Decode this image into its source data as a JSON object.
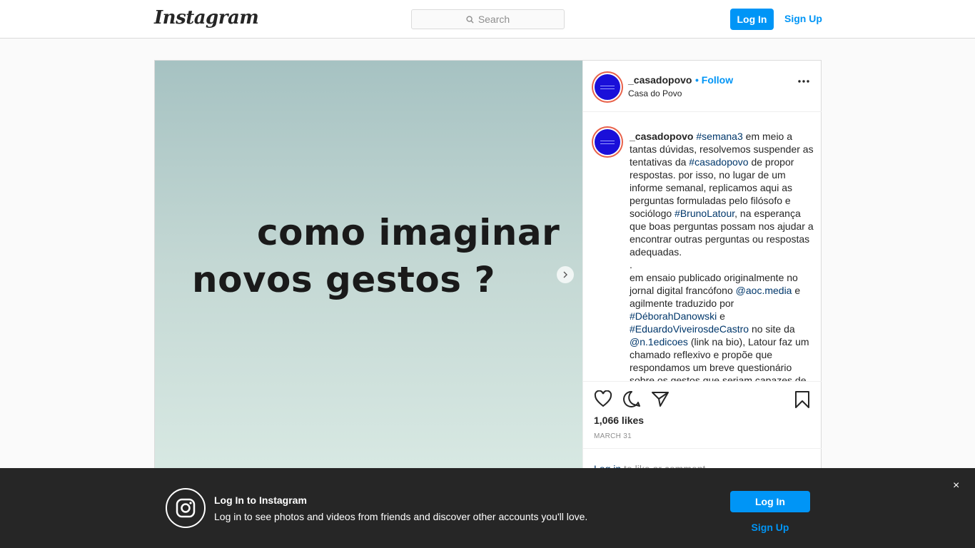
{
  "header": {
    "logo": "Instagram",
    "search_placeholder": "Search",
    "login_label": "Log In",
    "signup_label": "Sign Up"
  },
  "post": {
    "image_text_line1": "como imaginar",
    "image_text_line2": "novos gestos ?",
    "username": "_casadopovo",
    "follow_label": "• Follow",
    "full_name": "Casa do Povo",
    "caption": [
      {
        "t": "_casadopovo",
        "k": "u"
      },
      {
        "t": " ",
        "k": "p"
      },
      {
        "t": "#semana3",
        "k": "tag"
      },
      {
        "t": " em meio a tantas dúvidas, resolvemos suspender as tentativas da ",
        "k": "p"
      },
      {
        "t": "#casadopovo",
        "k": "tag"
      },
      {
        "t": " de propor respostas. por isso, no lugar de um informe semanal, replicamos aqui as perguntas formuladas pelo filósofo e sociólogo ",
        "k": "p"
      },
      {
        "t": "#BrunoLatour",
        "k": "tag"
      },
      {
        "t": ", na esperança que boas perguntas possam nos ajudar a encontrar outras perguntas ou respostas adequadas.",
        "k": "p"
      },
      {
        "t": "\n.\n",
        "k": "p"
      },
      {
        "t": "em ensaio publicado originalmente no jornal digital francófono ",
        "k": "p"
      },
      {
        "t": "@aoc.media",
        "k": "tag"
      },
      {
        "t": " e agilmente traduzido por ",
        "k": "p"
      },
      {
        "t": "#DéborahDanowski",
        "k": "tag"
      },
      {
        "t": " e ",
        "k": "p"
      },
      {
        "t": "#EduardoViveirosdeCastro",
        "k": "tag"
      },
      {
        "t": " no site da ",
        "k": "p"
      },
      {
        "t": "@n.1edicoes",
        "k": "tag"
      },
      {
        "t": " (link na bio), Latour faz um chamado reflexivo e propõe que respondamos um breve questionário sobre os gestos que seriam capazes de",
        "k": "p"
      }
    ],
    "likes": "1,066 likes",
    "date": "MARCH 31",
    "login_link": "Log in",
    "login_suffix": " to like or comment."
  },
  "banner": {
    "title": "Log In to Instagram",
    "text": "Log in to see photos and videos from friends and discover other accounts you'll love.",
    "login_label": "Log In",
    "signup_label": "Sign Up",
    "close_glyph": "×"
  },
  "icons": {
    "search": "search-icon",
    "next": "chevron-right-icon",
    "more": "more-options-icon",
    "heart": "heart-icon",
    "comment": "comment-icon",
    "share": "share-icon",
    "save": "bookmark-icon",
    "banner_logo": "instagram-logo-icon"
  },
  "colors": {
    "accent": "#0095f6",
    "link": "#00376b",
    "banner_bg": "#262626",
    "avatar_bg": "#1a0fd9"
  }
}
